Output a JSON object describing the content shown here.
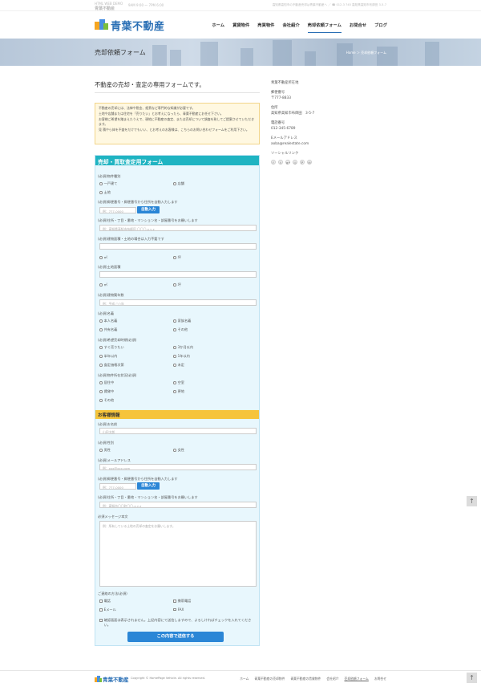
{
  "topbar": {
    "mini_line": "HTML WEB DEMO",
    "mini_logo": "青葉不動産",
    "hours": "9AM 9:00 ～ 7PM 6:00",
    "info": "高知県高知市の不動産売却は青葉不動産へ ／ ☎ 012-3 745 高知県高知市布師田 3-5-7"
  },
  "header": {
    "logo_text": "青葉不動産",
    "nav": [
      "ホーム",
      "賃貸物件",
      "売買物件",
      "会社紹介",
      "売却依頼フォーム",
      "お問合せ",
      "ブログ"
    ],
    "active_nav": "売却依頼フォーム"
  },
  "banner": {
    "title": "売却依頼フォーム",
    "breadcrumb": "Home ＞ 売却依頼フォーム"
  },
  "main": {
    "lead": "不動産の売却・査定の専用フォームです。",
    "notice": [
      "不動産の売却には、法律や税金、経費など専門的な知識が必要です。",
      "土地や店舗または住宅を「売りたい」とお考えになったら、青葉不動産にお任せ下さい。",
      "お客様ご希望を踏まえたうえで、現地に不動産の査定、または売却について調査を致してご提案させていただきます。",
      "見 積やら体を不査をだけでもいい、とお考えのお客様は、こちらのお問い合わせフォームをご利用下さい。"
    ]
  },
  "form": {
    "section1_title": "売却・買取査定用フォーム",
    "section2_title": "お客様情報",
    "q_property_type": "(必須)物件種別",
    "property_types": [
      "一戸建て",
      "店舗",
      "土地"
    ],
    "q_zip": "(必須)郵便番号・郵便番号から住所を自動入力します",
    "zip_placeholder": "例：777-0000",
    "auto_fill_label": "自動入力",
    "q_address": "(必須)住所・丁目・番地・マンション名・部屋番号をお願いします",
    "address_placeholder": "例：高知県高知市布師田 〇〇〇-x,y,z",
    "q_building_area": "(必須)建物面積・土地の場合は入力不要です",
    "unit_options_1": [
      "㎡",
      "坪"
    ],
    "q_land_area": "(必須)土地面積",
    "unit_options_2": [
      "㎡",
      "坪"
    ],
    "q_age": "(必須)建物築年数",
    "age_placeholder": "例：平成 ○○年",
    "q_title_holder": "(必須)名義",
    "title_holders": [
      "本人名義",
      "家族名義",
      "共有名義",
      "その他"
    ],
    "q_timing": "(必須)希望売却時期(必須)",
    "timings": [
      "すぐ売りたい",
      "3か月以内",
      "半年以内",
      "1年以内",
      "査定価格次第",
      "未定"
    ],
    "q_status": "(必須)物件所在状況(必須)",
    "statuses": [
      "居住中",
      "空室",
      "賃貸中",
      "更地",
      "その他"
    ],
    "q_name": "(必須)お名前",
    "name_placeholder": "山田太郎",
    "q_gender": "(必須)性別",
    "genders": [
      "男性",
      "女性"
    ],
    "q_email": "(必須)メールアドレス",
    "email_placeholder": "例：xxx@xxx.com",
    "q_zip2": "(必須)郵便番号・郵便番号から住所を自動入力します",
    "zip2_placeholder": "例：777-0000",
    "auto_fill_label2": "自動入力",
    "q_address2": "(必須)住所・丁目・番地・マンション名・部屋番号をお願いします",
    "address2_placeholder": "例：高知市〇〇町〇〇-x,y,z",
    "q_message": "必須メッセージ本文",
    "message_placeholder": "例：所有している土地の売却の査定をお願いします。",
    "q_contact": "ご連絡の方法(必須)",
    "contact_methods": [
      "電話",
      "携帯電話",
      "Eメール",
      "FAX"
    ],
    "confirm_text": "確認画面は表示されません。上記内容にて送信しますので、よろしければチェックを入れてください。",
    "submit_label": "この内容で送信する"
  },
  "sidebar": {
    "company": "青葉不動産所在地",
    "zip_label": "郵便番号",
    "zip_value": "〒777-8833",
    "addr_label": "住所",
    "addr_value": "高知県高知市布師田　3-5-7",
    "tel_label": "電話番号",
    "tel_value": "012-345-6789",
    "mail_label": "Eメールアドレス",
    "mail_value": "aoba@realestate.com",
    "social_label": "ソーシャルリンク",
    "social_icons": [
      "f",
      "t",
      "g+",
      "◎",
      "P",
      "✉"
    ]
  },
  "footer": {
    "logo_text": "青葉不動産",
    "copyright": "Copyright © HomePage Vehicle. All rights reserved.",
    "nav": [
      "ホーム",
      "青葉不動産の売却物件",
      "青葉不動産の賃貸物件",
      "会社紹介",
      "売却依頼フォーム",
      "お問合せ"
    ],
    "current": "売却依頼フォーム"
  },
  "scroll_top": "↑"
}
